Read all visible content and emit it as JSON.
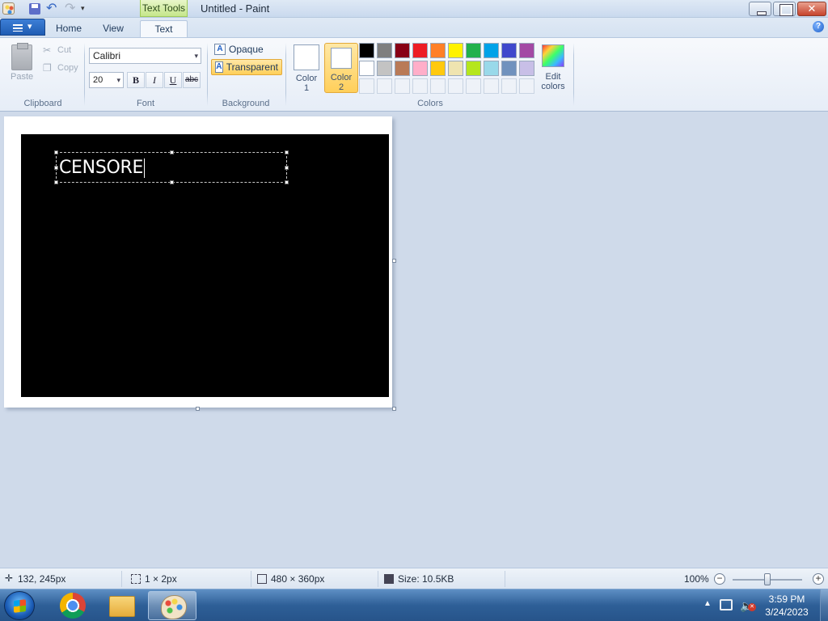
{
  "window": {
    "title": "Untitled - Paint",
    "contextual_tab": "Text Tools"
  },
  "tabs": {
    "home": "Home",
    "view": "View",
    "text": "Text"
  },
  "ribbon": {
    "clipboard": {
      "label": "Clipboard",
      "paste": "Paste",
      "cut": "Cut",
      "copy": "Copy"
    },
    "font": {
      "label": "Font",
      "family": "Calibri",
      "size": "20",
      "bold": "B",
      "italic": "I",
      "underline": "U",
      "strikethrough": "abc"
    },
    "background": {
      "label": "Background",
      "opaque": "Opaque",
      "transparent": "Transparent",
      "selected": "transparent"
    },
    "colors": {
      "label": "Colors",
      "color1_label_1": "Color",
      "color1_label_2": "1",
      "color2_label_1": "Color",
      "color2_label_2": "2",
      "color1_value": "#ffffff",
      "color2_value": "#ffffff",
      "edit_colors_1": "Edit",
      "edit_colors_2": "colors",
      "palette_row1": [
        "#000000",
        "#7f7f7f",
        "#880015",
        "#ed1c24",
        "#ff7f27",
        "#fff200",
        "#22b14c",
        "#00a2e8",
        "#3f48cc",
        "#a349a4"
      ],
      "palette_row2": [
        "#ffffff",
        "#c3c3c3",
        "#b97a57",
        "#ffaec9",
        "#ffc90e",
        "#efe4b0",
        "#b5e61d",
        "#99d9ea",
        "#7092be",
        "#c8bfe7"
      ],
      "palette_row3_empty": 10
    }
  },
  "canvas": {
    "text": "CENSORE",
    "background": "#ffffff",
    "shape_fill": "#000000",
    "text_color": "#ffffff"
  },
  "statusbar": {
    "cursor_pos": "132, 245px",
    "selection_size": "1 × 2px",
    "canvas_size": "480 × 360px",
    "file_size": "Size: 10.5KB",
    "zoom": "100%",
    "zoom_level_fraction": 0.5
  },
  "taskbar": {
    "time": "3:59 PM",
    "date": "3/24/2023"
  },
  "icons": {
    "app": "paint-icon",
    "save": "save-icon",
    "undo": "undo-icon",
    "redo": "redo-icon",
    "help": "help-icon",
    "start": "windows-start-icon",
    "chrome": "chrome-icon",
    "explorer": "explorer-icon"
  }
}
